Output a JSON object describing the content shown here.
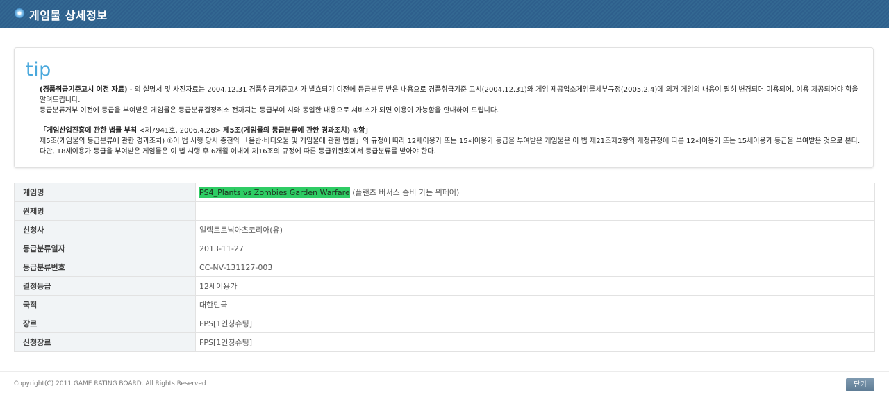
{
  "header": {
    "title": "게임물 상세정보",
    "icon": "circle-bullet-icon"
  },
  "tip": {
    "logo": "tip",
    "p1_bold": "(경품취급기준고시 이전 자료)",
    "p1_text": " - 의 설명서 및 사진자료는 2004.12.31 경품취급기준고시가 발효되기 이전에 등급분류 받은 내용으로 경품취급기준 고시(2004.12.31)와 게임 제공업소게임물세부규정(2005.2.4)에 의거 게임의 내용이 필히 변경되어 이용되어, 이용 제공되어야 함을 알려드립니다.",
    "p2": "등급분류거부 이전에 등급을 부여받은 게임물은 등급분류결정취소 전까지는 등급부여 시와 동일한 내용으로 서비스가 되면 이용이 가능함을 안내하여 드립니다.",
    "law_title_bold": "「게임산업진흥에 관한 법률 부칙",
    "law_title_normal": " <제7941호, 2006.4.28> ",
    "law_title_bold2": "제5조(게임물의 등급분류에 관한 경과조치) ①항」",
    "law_body": " 제5조(게임물의 등급분류에 관한 경과조치) ①이 법 시행 당시 종전의 「음반·비디오물 및 게임물에 관한 법률」의 규정에 따라 12세이용가 또는 15세이용가 등급을 부여받은 게임물은 이 법 제21조제2항의 개정규정에 따른 12세이용가 또는 15세이용가 등급을 부여받은 것으로 본다. 다만, 18세이용가 등급을 부여받은 게임물은 이 법 시행 후 6개월 이내에 제16조의 규정에 따른 등급위원회에서 등급분류를 받아야 한다."
  },
  "details": {
    "game_name_label": "게임명",
    "game_name_highlight": "PS4_Plants vs Zombies Garden Warfare",
    "game_name_korean": " (플랜츠 버서스 좀비 가든 워페어)",
    "original_title_label": "원제명",
    "original_title": "",
    "applicant_label": "신청사",
    "applicant": "일렉트로닉아츠코리아(유)",
    "rating_date_label": "등급분류일자",
    "rating_date": "2013-11-27",
    "rating_number_label": "등급분류번호",
    "rating_number": "CC-NV-131127-003",
    "decided_rating_label": "결정등급",
    "decided_rating": "12세이용가",
    "country_label": "국적",
    "country": "대한민국",
    "genre_label": "장르",
    "genre": "FPS[1인칭슈팅]",
    "applied_genre_label": "신청장르",
    "applied_genre": "FPS[1인칭슈팅]"
  },
  "footer": {
    "copyright": "Copyright(C) 2011 GAME RATING BOARD. All Rights Reserved",
    "close_label": "닫기"
  },
  "colors": {
    "header_bg": "#2e5f8c",
    "tip_logo": "#49a8dc",
    "highlight": "#2ecc64",
    "close_button": "#6a879f"
  }
}
